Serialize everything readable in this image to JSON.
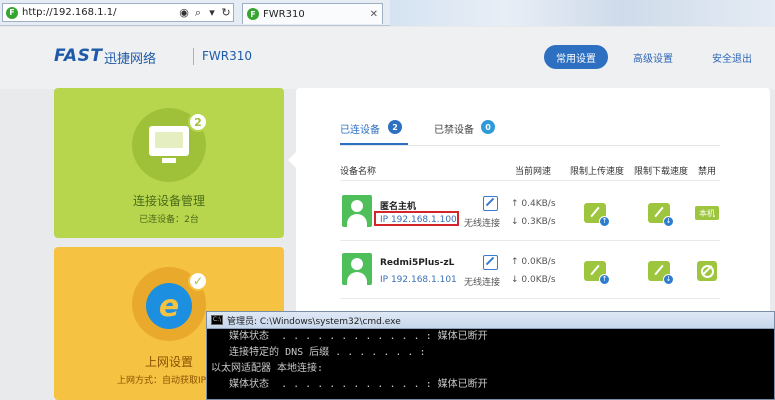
{
  "browser": {
    "url": "http://192.168.1.1/",
    "tab_title": "FWR310",
    "favicon": "F"
  },
  "header": {
    "logo": "FAST",
    "brand": "迅捷网络",
    "model": "FWR310",
    "nav": [
      {
        "label": "常用设置",
        "active": true
      },
      {
        "label": "高级设置",
        "active": false
      },
      {
        "label": "安全退出",
        "active": false
      }
    ]
  },
  "tiles": [
    {
      "title": "连接设备管理",
      "subtitle": "已连设备：2台",
      "badge": "2",
      "icon": "monitor-icon",
      "color": "#b7d64d"
    },
    {
      "title": "上网设置",
      "subtitle": "上网方式：自动获取IP",
      "icon": "internet-icon",
      "color": "#f6c242"
    }
  ],
  "devices": {
    "tabs": [
      {
        "label": "已连设备",
        "count": "2",
        "active": true,
        "badge_color": "#2d6fc0"
      },
      {
        "label": "已禁设备",
        "count": "0",
        "active": false,
        "badge_color": "#2d9ad9"
      }
    ],
    "columns": [
      "设备名称",
      "当前网速",
      "限制上传速度",
      "限制下载速度",
      "禁用"
    ],
    "rows": [
      {
        "name": "匿名主机",
        "ip": "IP 192.168.1.100",
        "conn": "无线连接",
        "up": "↑ 0.4KB/s",
        "down": "↓ 0.3KB/s",
        "ban": "本机",
        "highlighted": true
      },
      {
        "name": "Redmi5Plus-zL",
        "ip": "IP 192.168.1.101",
        "conn": "无线连接",
        "up": "↑ 0.0KB/s",
        "down": "↓ 0.0KB/s",
        "ban": "ban-icon",
        "highlighted": false
      }
    ]
  },
  "cmd": {
    "title": "管理员: C:\\Windows\\system32\\cmd.exe",
    "lines": [
      "   媒体状态  . . . . . . . . . . . . : 媒体已断开",
      "   连接特定的 DNS 后缀 . . . . . . . :",
      "以太网适配器 本地连接:",
      "   媒体状态  . . . . . . . . . . . . : 媒体已断开"
    ]
  }
}
